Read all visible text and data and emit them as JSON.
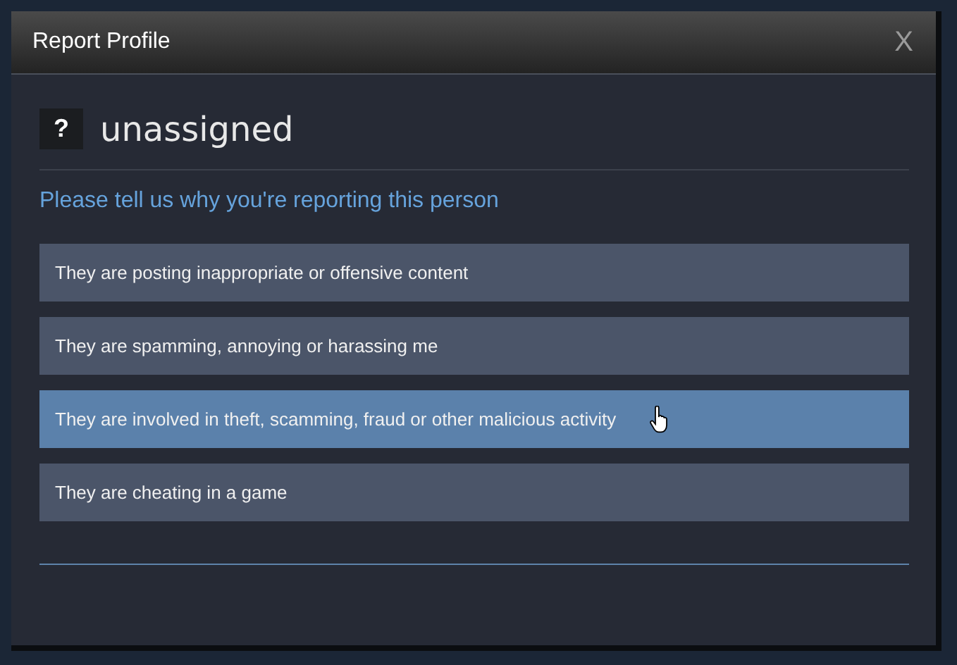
{
  "window": {
    "title": "Report Profile",
    "close": "X"
  },
  "profile": {
    "avatar": "?",
    "name": "unassigned"
  },
  "prompt": "Please tell us why you're reporting this person",
  "options": [
    {
      "label": "They are posting inappropriate or offensive content",
      "hovered": false
    },
    {
      "label": "They are spamming, annoying or harassing me",
      "hovered": false
    },
    {
      "label": "They are involved in theft, scamming, fraud or other malicious activity",
      "hovered": true
    },
    {
      "label": "They are cheating in a game",
      "hovered": false
    }
  ]
}
